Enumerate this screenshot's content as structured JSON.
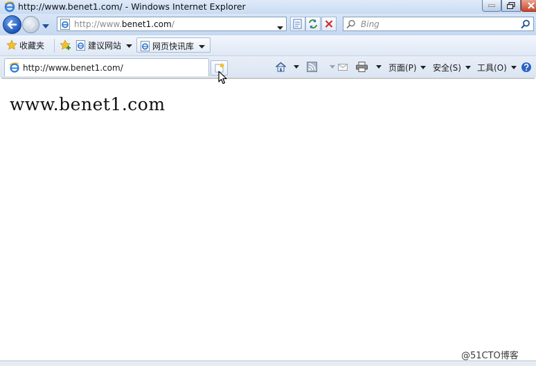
{
  "window": {
    "title": "http://www.benet1.com/ - Windows Internet Explorer"
  },
  "address_bar": {
    "url_prefix": "http://www.",
    "url_domain": "benet1.com",
    "url_suffix": "/"
  },
  "search": {
    "placeholder": "Bing"
  },
  "favorites_bar": {
    "favorites_label": "收藏夹",
    "items": [
      {
        "label": "建议网站",
        "icon": "ie-page-icon"
      },
      {
        "label": "网页快讯库",
        "icon": "ie-page-icon"
      }
    ]
  },
  "tab": {
    "title": "http://www.benet1.com/"
  },
  "command_bar": {
    "page_label": "页面(P)",
    "safety_label": "安全(S)",
    "tools_label": "工具(O)"
  },
  "content": {
    "text": "www.benet1.com"
  },
  "watermark": "@51CTO博客"
}
